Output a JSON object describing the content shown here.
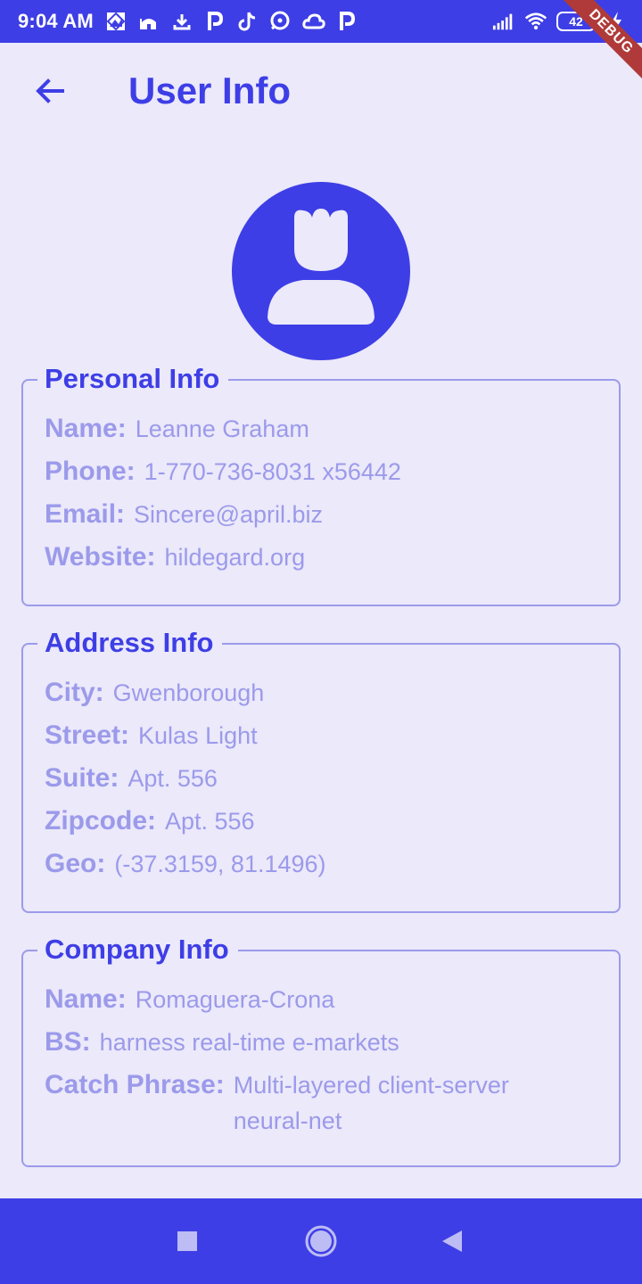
{
  "status_bar": {
    "time": "9:04 AM",
    "battery_level": "42",
    "icons": [
      "gallery-icon",
      "mosque-icon",
      "download-icon",
      "p-app-icon",
      "tiktok-icon",
      "chat-icon",
      "cloud-icon",
      "p-app-icon",
      "signal-icon",
      "wifi-icon",
      "battery-icon",
      "charging-icon"
    ]
  },
  "debug_banner": "DEBUG",
  "app_bar": {
    "title": "User Info",
    "back_icon": "arrow-left-icon"
  },
  "avatar": {
    "icon": "person-icon",
    "color": "#3E3EE6"
  },
  "personal_info": {
    "title": "Personal Info",
    "rows": [
      {
        "label": "Name:",
        "value": "Leanne Graham"
      },
      {
        "label": "Phone:",
        "value": "1-770-736-8031 x56442"
      },
      {
        "label": "Email:",
        "value": "Sincere@april.biz"
      },
      {
        "label": "Website:",
        "value": "hildegard.org"
      }
    ]
  },
  "address_info": {
    "title": "Address Info",
    "rows": [
      {
        "label": "City:",
        "value": "Gwenborough"
      },
      {
        "label": "Street:",
        "value": "Kulas Light"
      },
      {
        "label": "Suite:",
        "value": "Apt. 556"
      },
      {
        "label": "Zipcode:",
        "value": "Apt. 556"
      },
      {
        "label": "Geo:",
        "value": "(-37.3159, 81.1496)"
      }
    ]
  },
  "company_info": {
    "title": "Company Info",
    "rows": [
      {
        "label": "Name:",
        "value": "Romaguera-Crona"
      },
      {
        "label": "BS:",
        "value": "harness real-time e-markets"
      },
      {
        "label": "Catch Phrase:",
        "value": "Multi-layered client-server neural-net"
      }
    ]
  },
  "nav_bar": {
    "buttons": [
      "recents-square-icon",
      "home-circle-icon",
      "back-triangle-icon"
    ]
  },
  "colors": {
    "primary": "#3E3EE6",
    "background": "#EBE9FA",
    "muted_text": "#9C9AEA",
    "debug_ribbon": "#B03A3A"
  }
}
